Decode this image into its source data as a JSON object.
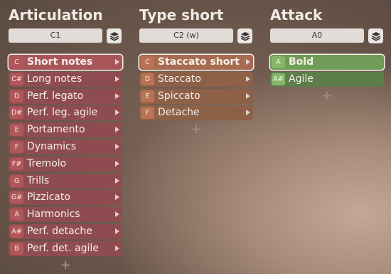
{
  "columns": [
    {
      "title": "Articulation",
      "note": "C1",
      "theme": "red",
      "selected": 0,
      "items": [
        {
          "key": "C",
          "label": "Short notes"
        },
        {
          "key": "C#",
          "label": "Long notes"
        },
        {
          "key": "D",
          "label": "Perf. legato"
        },
        {
          "key": "D#",
          "label": "Perf. leg. agile"
        },
        {
          "key": "E",
          "label": "Portamento"
        },
        {
          "key": "F",
          "label": "Dynamics"
        },
        {
          "key": "F#",
          "label": "Tremolo"
        },
        {
          "key": "G",
          "label": "Trills"
        },
        {
          "key": "G#",
          "label": "Pizzicato"
        },
        {
          "key": "A",
          "label": "Harmonics"
        },
        {
          "key": "A#",
          "label": "Perf. detache"
        },
        {
          "key": "B",
          "label": "Perf. det. agile"
        }
      ],
      "add_label": "+"
    },
    {
      "title": "Type short",
      "note": "C2 (w)",
      "theme": "orange",
      "selected": 0,
      "items": [
        {
          "key": "C",
          "label": "Staccato short"
        },
        {
          "key": "D",
          "label": "Staccato"
        },
        {
          "key": "E",
          "label": "Spiccato"
        },
        {
          "key": "F",
          "label": "Detache"
        }
      ],
      "add_label": "+"
    },
    {
      "title": "Attack",
      "note": "A0",
      "theme": "green",
      "selected": 0,
      "items": [
        {
          "key": "A",
          "label": "Bold"
        },
        {
          "key": "A#",
          "label": "Agile"
        }
      ],
      "add_label": "+"
    }
  ],
  "icons": {
    "layers": "layers-icon",
    "arrow": "chevron-right-icon"
  }
}
